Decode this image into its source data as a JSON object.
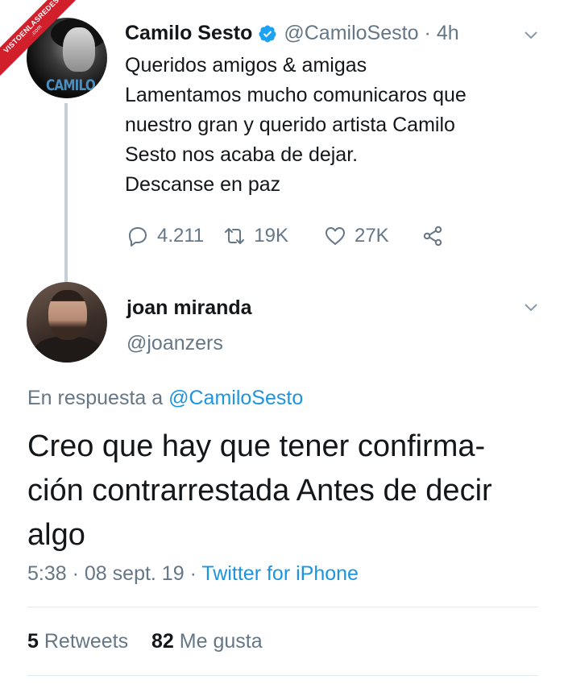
{
  "watermark": {
    "text": "VISTOENLASREDES",
    "sub": ".com"
  },
  "tweet": {
    "avatar_text": "CAMILO",
    "name": "Camilo Sesto",
    "handle": "@CamiloSesto",
    "separator": "·",
    "time": "4h",
    "lines": [
      "Queridos amigos & amigas",
      "Lamentamos mucho comunicaros que",
      "nuestro gran y querido artista Camilo",
      "Sesto nos acaba de dejar.",
      "Descanse en paz"
    ],
    "actions": {
      "replies": "4.211",
      "retweets": "19K",
      "likes": "27K"
    }
  },
  "reply": {
    "name": "joan miranda",
    "handle": "@joanzers",
    "reply_prefix": "En respuesta a",
    "reply_mention": "@CamiloSesto",
    "lines": [
      "Creo que hay que tener confirma-",
      "ción contrarrestada Antes de decir",
      "algo"
    ],
    "time": "5:38",
    "date": "08 sept. 19",
    "client": "Twitter for iPhone",
    "retweet_count": "5",
    "retweet_label": "Retweets",
    "like_count": "82",
    "like_label": "Me gusta"
  },
  "colors": {
    "text": "#14171a",
    "secondary": "#657786",
    "link": "#1b95e0",
    "verified": "#1da1f2",
    "thread_line": "#c4cfd6",
    "divider": "#e1e8ed"
  }
}
